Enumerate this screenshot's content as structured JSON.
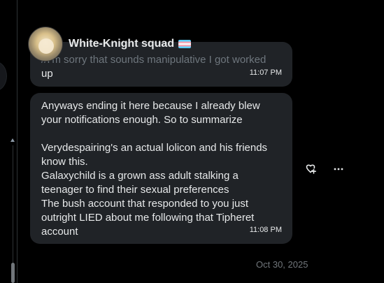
{
  "header": {
    "name": "White-Knight squad",
    "flag_icon": "trans-flag-icon"
  },
  "messages": [
    {
      "lines": [
        "//I'm sorry that sounds manipulative I got worked",
        "up"
      ],
      "time": "11:07 PM"
    },
    {
      "lines": [
        "Anyways ending it here because I already blew",
        "your notifications enough. So to summarize",
        "",
        "Verydespairing's an actual lolicon and his friends",
        "know this.",
        "Galaxychild is a grown ass adult stalking a",
        "teenager to find their sexual preferences",
        "The bush account that responded to you just",
        "outright LIED about me following that Tipheret",
        "account"
      ],
      "time": "11:08 PM"
    }
  ],
  "actions": {
    "react_icon": "add-reaction-icon",
    "more_icon": "more-options-icon"
  },
  "date_separator": "Oct 30, 2025",
  "colors": {
    "background": "#000000",
    "bubble": "#202327",
    "text": "#e7e9ea",
    "muted": "#71767b"
  }
}
